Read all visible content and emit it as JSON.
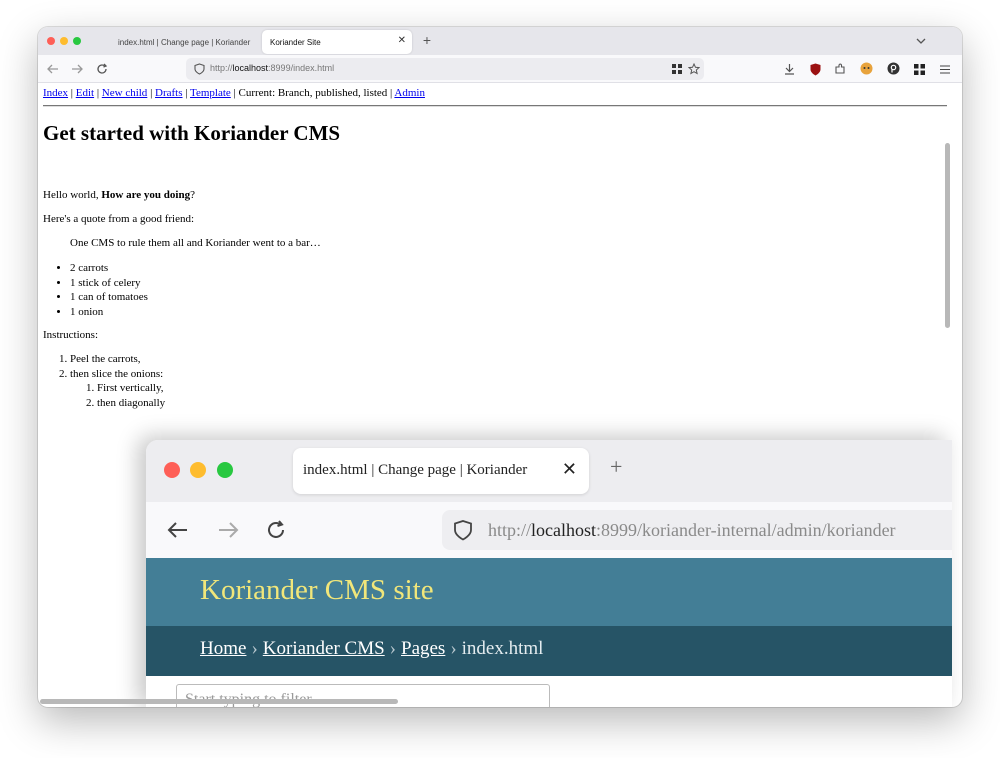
{
  "browser": {
    "tabs": [
      {
        "label": "index.html | Change page | Koriander"
      },
      {
        "label": "Koriander Site"
      }
    ],
    "close_glyph": "✕",
    "new_tab_glyph": "+",
    "url": {
      "protocol": "http://",
      "host": "localhost",
      "rest": ":8999/index.html"
    },
    "colors": {
      "close": "#fe5f57",
      "minimize": "#febc2e",
      "maximize": "#28c840"
    },
    "toolbar_icons": [
      "back-icon",
      "forward-icon",
      "reload-icon",
      "shield-icon",
      "grid-icon",
      "bookmark-star-icon",
      "download-icon",
      "ublock-icon",
      "extensions-icon",
      "profile-icon",
      "pocket-icon",
      "apps-icon",
      "menu-icon",
      "tabs-list-icon"
    ]
  },
  "page": {
    "nav": {
      "index": "Index",
      "edit": "Edit",
      "new_child": "New child",
      "drafts": "Drafts",
      "template": "Template",
      "current": "Current: Branch, published, listed",
      "admin": "Admin",
      "sep": " | "
    },
    "heading": "Get started with Koriander CMS",
    "hello": {
      "text": "Hello world, ",
      "bold": "How are you doing",
      "tail": "?"
    },
    "quote_intro": "Here's a quote from a good friend:",
    "quote": "One CMS to rule them all and Koriander went to a bar…",
    "ingredients": [
      "2 carrots",
      "1 stick of celery",
      "1 can of tomatoes",
      "1 onion"
    ],
    "instructions_label": "Instructions:",
    "steps": [
      "Peel the carrots,",
      "then slice the onions:"
    ],
    "substeps": [
      "First vertically,",
      "then diagonally"
    ]
  },
  "inner_screenshot": {
    "tab_label": "index.html | Change page | Koriander",
    "url": {
      "protocol": "http://",
      "host": "localhost",
      "rest": ":8999/koriander-internal/admin/koriander"
    },
    "site_title": "Koriander CMS site",
    "breadcrumbs": [
      "Home",
      "Koriander CMS",
      "Pages"
    ],
    "breadcrumb_current": "index.html",
    "breadcrumb_sep": "›",
    "filter_placeholder": "Start typing to filter..."
  }
}
